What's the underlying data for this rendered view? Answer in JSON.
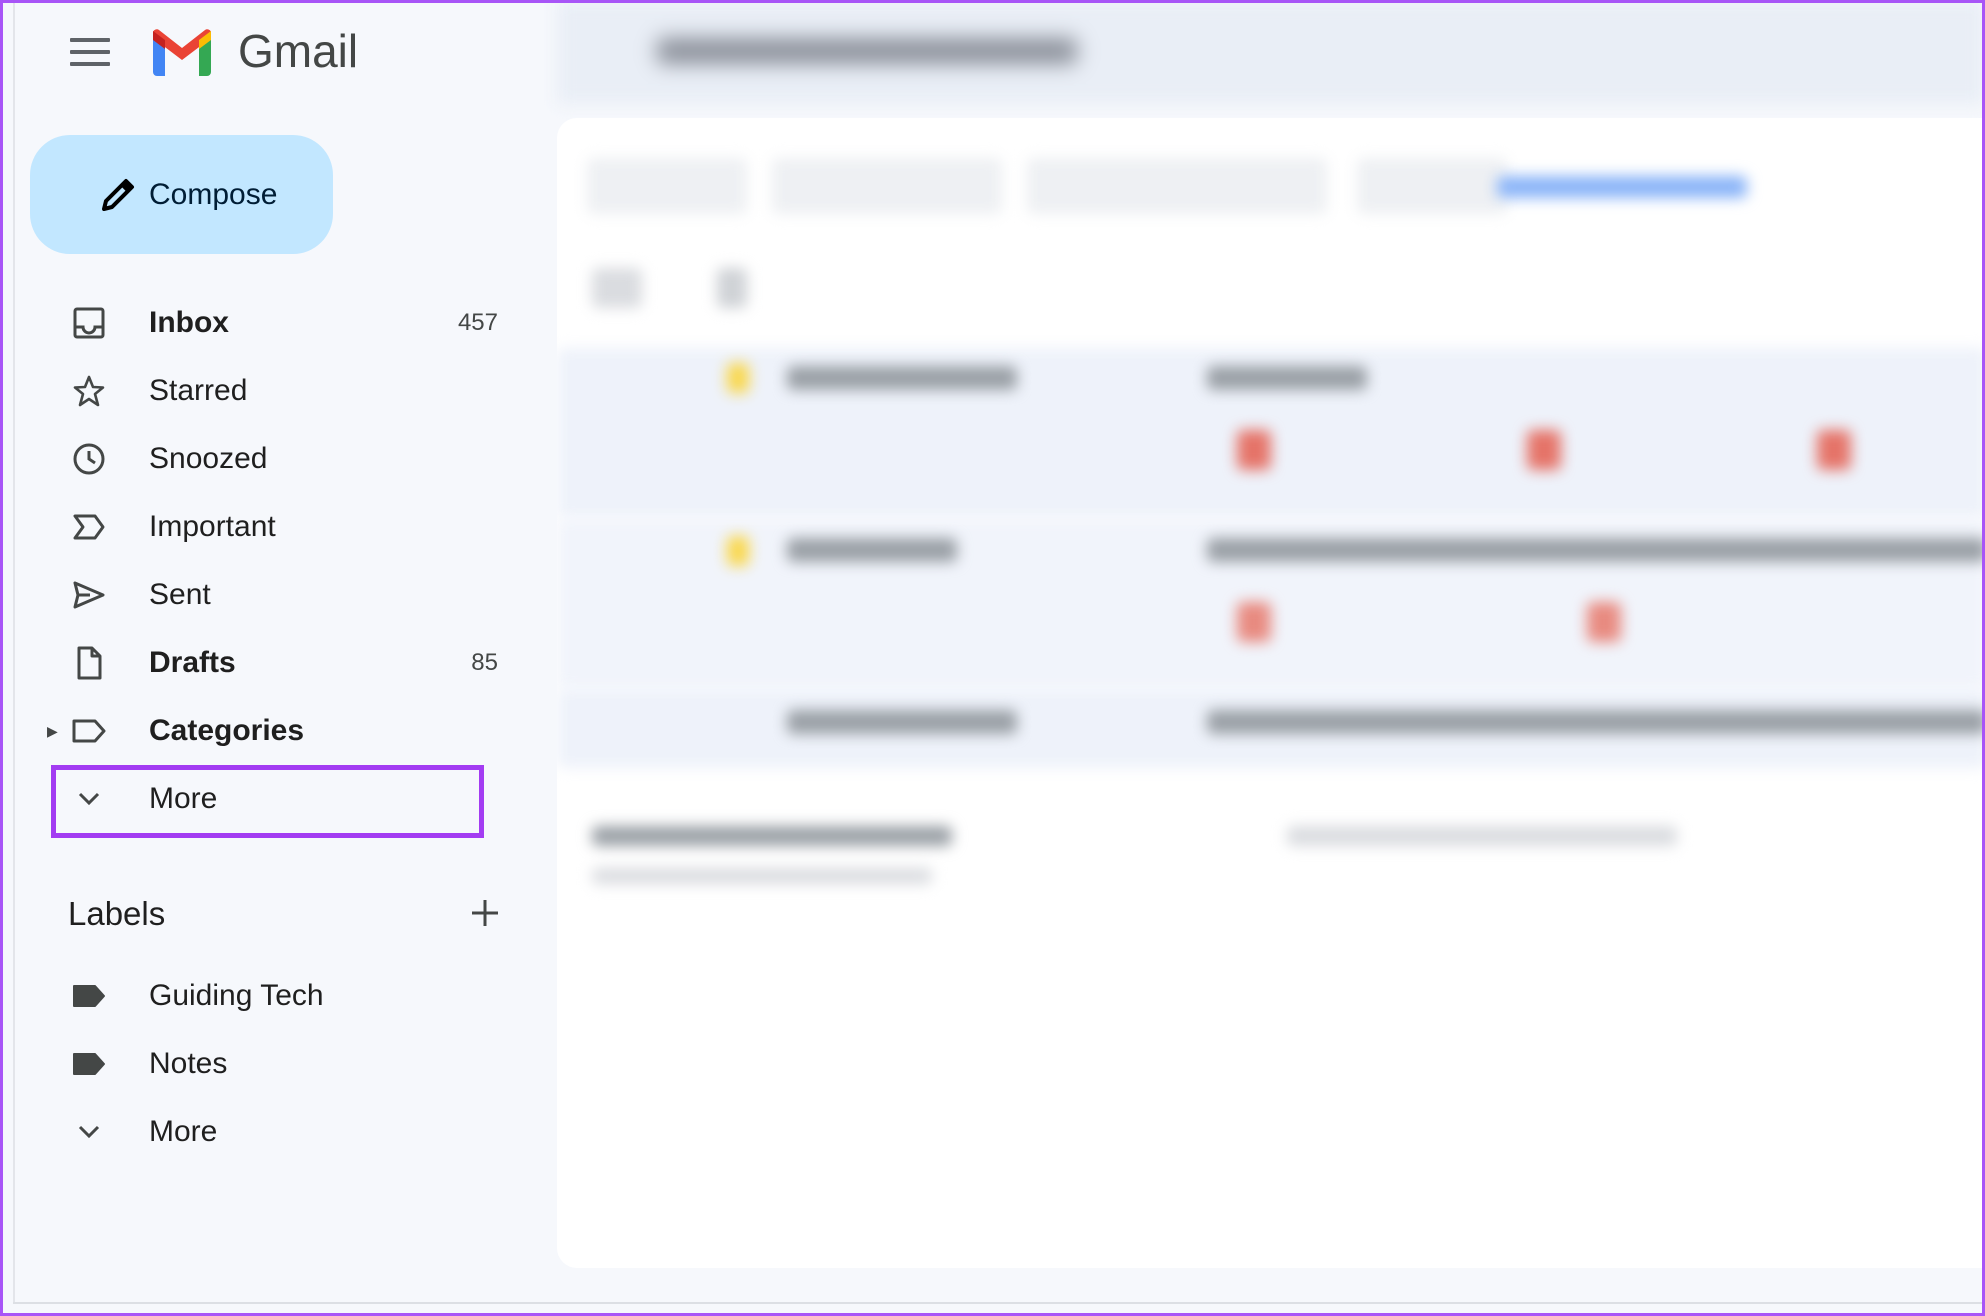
{
  "app": {
    "name": "Gmail",
    "menu_icon": "hamburger-menu-icon",
    "logo": "gmail-m-logo"
  },
  "compose": {
    "label": "Compose",
    "icon": "pencil-icon",
    "bg": "#c2e7ff"
  },
  "nav": [
    {
      "label": "Inbox",
      "count": "457",
      "icon": "inbox-icon",
      "bold": true
    },
    {
      "label": "Starred",
      "count": "",
      "icon": "star-icon",
      "bold": false
    },
    {
      "label": "Snoozed",
      "count": "",
      "icon": "clock-icon",
      "bold": false
    },
    {
      "label": "Important",
      "count": "",
      "icon": "important-icon",
      "bold": false
    },
    {
      "label": "Sent",
      "count": "",
      "icon": "send-icon",
      "bold": false
    },
    {
      "label": "Drafts",
      "count": "85",
      "icon": "draft-icon",
      "bold": true
    },
    {
      "label": "Categories",
      "count": "",
      "icon": "label-outline-icon",
      "bold": true
    },
    {
      "label": "More",
      "count": "",
      "icon": "chevron-down-icon",
      "bold": false,
      "highlighted": true
    }
  ],
  "labels": {
    "heading": "Labels",
    "add_icon": "plus-icon",
    "items": [
      {
        "label": "Guiding Tech",
        "icon": "label-icon"
      },
      {
        "label": "Notes",
        "icon": "label-icon"
      },
      {
        "label": "More",
        "icon": "chevron-down-icon"
      }
    ]
  },
  "colors": {
    "highlight": "#a33cf2",
    "background": "#f6f8fc",
    "frame": "#a855f7"
  }
}
